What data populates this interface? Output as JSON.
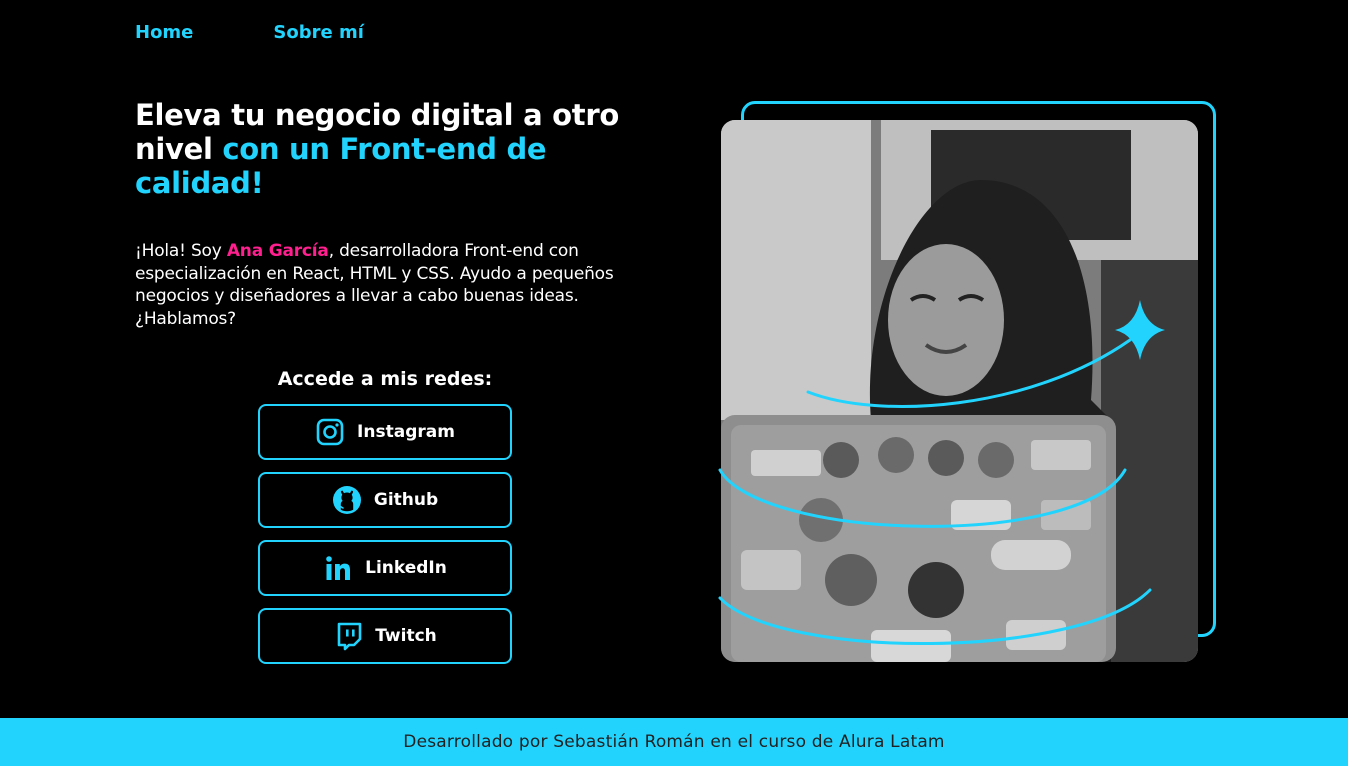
{
  "nav": {
    "items": [
      {
        "label": "Home"
      },
      {
        "label": "Sobre mí"
      }
    ]
  },
  "hero": {
    "title_part1": "Eleva tu negocio digital a otro nivel",
    "title_part2": "con un Front-end de calidad!",
    "intro_prefix": "¡Hola! Soy",
    "intro_name": "Ana García",
    "intro_suffix": ", desarrolladora Front-end con especialización en React, HTML y CSS. Ayudo a pequeños negocios y diseñadores a llevar a cabo buenas ideas. ¿Hablamos?"
  },
  "social": {
    "title": "Accede a mis redes:",
    "buttons": [
      {
        "label": "Instagram",
        "icon": "instagram-icon"
      },
      {
        "label": "Github",
        "icon": "github-icon"
      },
      {
        "label": "LinkedIn",
        "icon": "linkedin-icon"
      },
      {
        "label": "Twitch",
        "icon": "twitch-icon"
      }
    ]
  },
  "footer": {
    "text": "Desarrollado por Sebastián Román en el curso de Alura Latam"
  },
  "colors": {
    "background": "#000000",
    "accent": "#22d4fd",
    "highlight": "#ff1f8f",
    "text": "#ffffff"
  }
}
